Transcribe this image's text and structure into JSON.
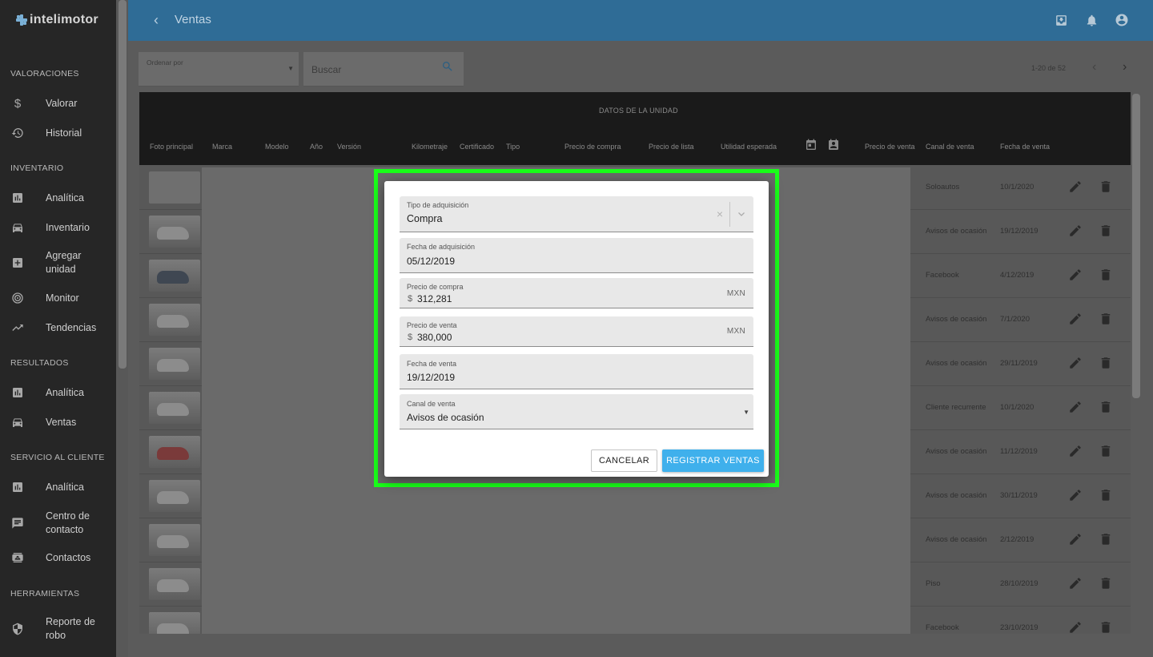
{
  "app": {
    "logo_text": "intelimotor"
  },
  "sidebar": {
    "sections": [
      {
        "title": "VALORACIONES",
        "items": [
          {
            "label": "Valorar",
            "icon": "dollar-icon"
          },
          {
            "label": "Historial",
            "icon": "history-icon"
          }
        ]
      },
      {
        "title": "INVENTARIO",
        "items": [
          {
            "label": "Analítica",
            "icon": "chart-icon"
          },
          {
            "label": "Inventario",
            "icon": "car-icon"
          },
          {
            "label": "Agregar unidad",
            "icon": "add-box-icon"
          },
          {
            "label": "Monitor",
            "icon": "radar-icon"
          },
          {
            "label": "Tendencias",
            "icon": "trending-icon"
          }
        ]
      },
      {
        "title": "RESULTADOS",
        "items": [
          {
            "label": "Analítica",
            "icon": "chart-icon"
          },
          {
            "label": "Ventas",
            "icon": "car-icon"
          }
        ]
      },
      {
        "title": "SERVICIO AL CLIENTE",
        "items": [
          {
            "label": "Analítica",
            "icon": "chart-icon"
          },
          {
            "label": "Centro de contacto",
            "icon": "chat-icon"
          },
          {
            "label": "Contactos",
            "icon": "contacts-icon"
          }
        ]
      },
      {
        "title": "HERRAMIENTAS",
        "items": [
          {
            "label": "Reporte de robo",
            "icon": "shield-icon"
          }
        ]
      }
    ]
  },
  "topbar": {
    "title": "Ventas"
  },
  "controls": {
    "sort_label": "Ordenar por",
    "search_placeholder": "Buscar",
    "pager": "1-20 de 52"
  },
  "table": {
    "group_header": "DATOS DE LA UNIDAD",
    "columns": [
      "Foto principal",
      "Marca",
      "Modelo",
      "Año",
      "Versión",
      "Kilometraje",
      "Certificado",
      "Tipo",
      "Precio de compra",
      "Precio de lista",
      "Utilidad esperada",
      "Precio de venta",
      "Canal de venta",
      "Fecha de venta"
    ],
    "rows": [
      {
        "canal": "Soloautos",
        "fecha": "10/1/2020",
        "photo": "placeholder"
      },
      {
        "canal": "Avisos de ocasión",
        "fecha": "19/12/2019",
        "photo": "car"
      },
      {
        "canal": "Facebook",
        "fecha": "4/12/2019",
        "photo": "dark"
      },
      {
        "canal": "Avisos de ocasión",
        "fecha": "7/1/2020",
        "photo": "car"
      },
      {
        "canal": "Avisos de ocasión",
        "fecha": "29/11/2019",
        "photo": "car"
      },
      {
        "canal": "Cliente recurrente",
        "fecha": "10/1/2020",
        "photo": "car"
      },
      {
        "canal": "Avisos de ocasión",
        "fecha": "11/12/2019",
        "photo": "red"
      },
      {
        "canal": "Avisos de ocasión",
        "fecha": "30/11/2019",
        "photo": "car"
      },
      {
        "canal": "Avisos de ocasión",
        "fecha": "2/12/2019",
        "photo": "car"
      },
      {
        "canal": "Piso",
        "fecha": "28/10/2019",
        "photo": "car"
      },
      {
        "canal": "Facebook",
        "fecha": "23/10/2019",
        "photo": "car"
      }
    ]
  },
  "dialog": {
    "tipo_adquisicion": {
      "label": "Tipo de adquisición",
      "value": "Compra"
    },
    "fecha_adquisicion": {
      "label": "Fecha de adquisición",
      "value": "05/12/2019"
    },
    "precio_compra": {
      "label": "Precio de compra",
      "prefix": "$",
      "value": "312,281",
      "currency": "MXN"
    },
    "precio_venta": {
      "label": "Precio de venta",
      "prefix": "$",
      "value": "380,000",
      "currency": "MXN"
    },
    "fecha_venta": {
      "label": "Fecha de venta",
      "value": "19/12/2019"
    },
    "canal_venta": {
      "label": "Canal de venta",
      "value": "Avisos de ocasión"
    },
    "cancel_label": "CANCELAR",
    "register_label": "REGISTRAR VENTAS"
  },
  "colors": {
    "accent": "#3fb0ec",
    "highlight": "#19ff19",
    "topbar": "#2f6c96",
    "sidebar": "#262626"
  }
}
